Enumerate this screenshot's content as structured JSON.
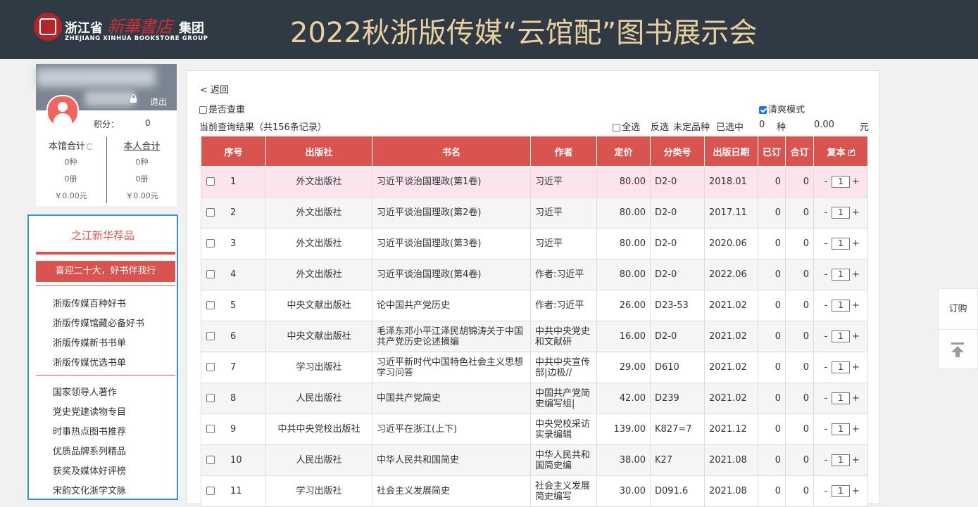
{
  "header": {
    "logo_province": "浙江省",
    "logo_brush": "新華書店",
    "logo_group": "集团",
    "logo_en": "ZHEJIANG XINHUA BOOKSTORE GROUP",
    "title": "2022秋浙版传媒“云馆配”图书展示会",
    "bg_color": "#2f3a44",
    "title_color": "#e9cf9d"
  },
  "user": {
    "logout": "退出",
    "points_label": "积分：",
    "points_value": "0",
    "library_total": {
      "label": "本馆合计",
      "kinds": "0种",
      "copies": "0册",
      "amount": "￥0.00元"
    },
    "personal_total": {
      "label": "本人合计",
      "kinds": "0种",
      "copies": "0册",
      "amount": "￥0.00元"
    }
  },
  "menu": {
    "heading": "之江新华荐品",
    "banner": "喜迎二十大，好书伴我行",
    "group1": [
      "浙版传媒百种好书",
      "浙版传媒馆藏必备好书",
      "浙版传媒新书书单",
      "浙版传媒优选书单"
    ],
    "group2": [
      "国家领导人著作",
      "党史党建读物专目",
      "时事热点图书推荐",
      "优质品牌系列精品",
      "获奖及媒体好评榜",
      "宋韵文化浙学文脉"
    ],
    "accent_color": "#d9534f",
    "border_color": "#3a93d6"
  },
  "toolbar": {
    "back": "< 返回",
    "dup_check": "是否查重",
    "clean_mode": "清爽模式",
    "result_info": "当前查询结果（共156条记录）",
    "select_all": "全选",
    "invert": "反选",
    "undecided": "未定品种",
    "selected_label": "已选中",
    "selected_count": "0",
    "kinds_unit": "种",
    "amount": "0.00",
    "currency": "元"
  },
  "table": {
    "headers": [
      "序号",
      "出版社",
      "书名",
      "作者",
      "定价",
      "分类号",
      "出版日期",
      "已订",
      "合订",
      "复本"
    ],
    "rows": [
      [
        "1",
        "外文出版社",
        "习近平谈治国理政(第1卷)",
        "习近平",
        "80.00",
        "D2-0",
        "2018.01",
        "0",
        "0",
        "1"
      ],
      [
        "2",
        "外文出版社",
        "习近平谈治国理政(第2卷)",
        "习近平",
        "80.00",
        "D2-0",
        "2017.11",
        "0",
        "0",
        "1"
      ],
      [
        "3",
        "外文出版社",
        "习近平谈治国理政(第3卷)",
        "习近平",
        "80.00",
        "D2-0",
        "2020.06",
        "0",
        "0",
        "1"
      ],
      [
        "4",
        "外文出版社",
        "习近平谈治国理政(第4卷)",
        "作者:习近平",
        "80.00",
        "D2-0",
        "2022.06",
        "0",
        "0",
        "1"
      ],
      [
        "5",
        "中央文献出版社",
        "论中国共产党历史",
        "作者:习近平",
        "26.00",
        "D23-53",
        "2021.02",
        "0",
        "0",
        "1"
      ],
      [
        "6",
        "中央文献出版社",
        "毛泽东邓小平江泽民胡锦涛关于中国共产党历史论述摘编",
        "中共中央党史和文献研",
        "16.00",
        "D2-0",
        "2021.02",
        "0",
        "0",
        "1"
      ],
      [
        "7",
        "学习出版社",
        "习近平新时代中国特色社会主义思想学习问答",
        "中共中央宣传部|边极//",
        "29.00",
        "D610",
        "2021.02",
        "0",
        "0",
        "1"
      ],
      [
        "8",
        "人民出版社",
        "中国共产党简史",
        "中国共产党简史编写组|",
        "42.00",
        "D239",
        "2021.02",
        "0",
        "0",
        "1"
      ],
      [
        "9",
        "中共中央党校出版社",
        "习近平在浙江(上下)",
        "中央党校采访实录编辑",
        "139.00",
        "K827=7",
        "2021.12",
        "0",
        "0",
        "1"
      ],
      [
        "10",
        "人民出版社",
        "中华人民共和国简史",
        "中华人民共和国简史编",
        "38.00",
        "K27",
        "2021.08",
        "0",
        "0",
        "1"
      ],
      [
        "11",
        "学习出版社",
        "社会主义发展简史",
        "社会主义发展简史编写",
        "30.00",
        "D091.6",
        "2021.08",
        "0",
        "0",
        "1"
      ]
    ],
    "header_color": "#d9534f",
    "highlight_color": "#fce4ec"
  },
  "float": {
    "order": "订购"
  }
}
